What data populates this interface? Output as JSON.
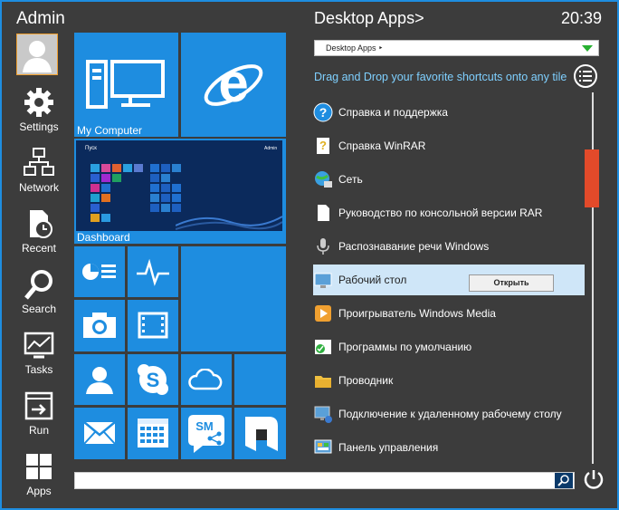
{
  "user": {
    "name": "Admin"
  },
  "sidebar": {
    "items": [
      {
        "label": "Settings",
        "icon": "gear-icon"
      },
      {
        "label": "Network",
        "icon": "network-icon"
      },
      {
        "label": "Recent",
        "icon": "recent-icon"
      },
      {
        "label": "Search",
        "icon": "search-icon"
      },
      {
        "label": "Tasks",
        "icon": "tasks-icon"
      },
      {
        "label": "Run",
        "icon": "run-icon"
      },
      {
        "label": "Apps",
        "icon": "apps-icon"
      }
    ]
  },
  "tiles": {
    "my_computer": "My Computer",
    "dashboard": "Dashboard",
    "dashboard_preview": {
      "start_label": "Пуск",
      "user_label": "Admin"
    }
  },
  "header": {
    "title": "Desktop Apps>",
    "time": "20:39"
  },
  "dropdown": {
    "value": "Desktop Apps ‣"
  },
  "hint": "Drag and Drop your favorite shortcuts onto any tile",
  "apps": [
    {
      "label": "Справка и поддержка",
      "icon": "help-icon"
    },
    {
      "label": "Справка WinRAR",
      "icon": "winrar-help-icon"
    },
    {
      "label": "Сеть",
      "icon": "network-globe-icon"
    },
    {
      "label": "Руководство по консольной версии RAR",
      "icon": "document-icon"
    },
    {
      "label": "Распознавание речи Windows",
      "icon": "microphone-icon"
    },
    {
      "label": "Рабочий стол",
      "icon": "desktop-icon"
    },
    {
      "label": "Проигрыватель Windows Media",
      "icon": "media-player-icon"
    },
    {
      "label": "Программы по умолчанию",
      "icon": "default-programs-icon"
    },
    {
      "label": "Проводник",
      "icon": "explorer-folder-icon"
    },
    {
      "label": "Подключение к удаленному рабочему столу",
      "icon": "remote-desktop-icon"
    },
    {
      "label": "Панель управления",
      "icon": "control-panel-icon"
    }
  ],
  "context_menu": {
    "open_label": "Открыть"
  },
  "colors": {
    "accent": "#1e8de0",
    "background": "#3c3c3c",
    "scroll_thumb": "#e24a2a",
    "hint": "#7fd0ff"
  }
}
